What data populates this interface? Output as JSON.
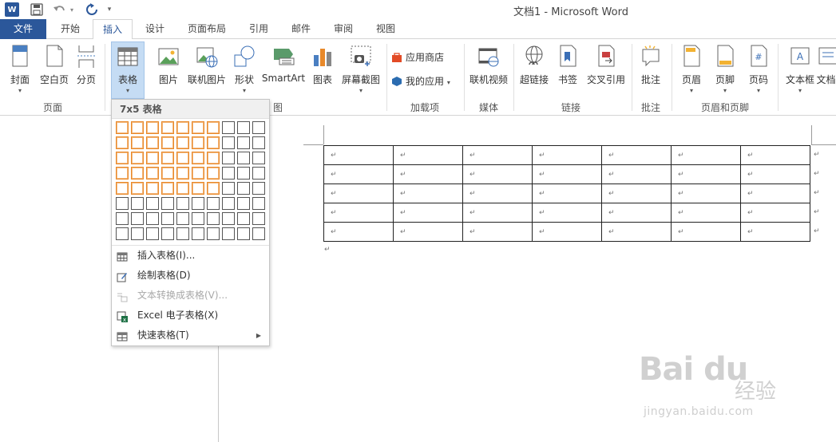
{
  "window": {
    "title": "文档1 - Microsoft Word"
  },
  "quick_access": {
    "logo_letter": "W",
    "undo_drop": "▾",
    "more": "▾"
  },
  "tabs": [
    {
      "label": "文件",
      "id": "file"
    },
    {
      "label": "开始",
      "id": "home"
    },
    {
      "label": "插入",
      "id": "insert",
      "active": true
    },
    {
      "label": "设计",
      "id": "design"
    },
    {
      "label": "页面布局",
      "id": "layout"
    },
    {
      "label": "引用",
      "id": "references"
    },
    {
      "label": "邮件",
      "id": "mailings"
    },
    {
      "label": "审阅",
      "id": "review"
    },
    {
      "label": "视图",
      "id": "view"
    }
  ],
  "ribbon": {
    "buttons": [
      {
        "label": "封面",
        "icon": "cover-page-icon",
        "dropdown": "▾"
      },
      {
        "label": "空白页",
        "icon": "blank-page-icon"
      },
      {
        "label": "分页",
        "icon": "page-break-icon"
      },
      {
        "label": "表格",
        "icon": "table-icon",
        "dropdown": "▾",
        "selected": true
      },
      {
        "label": "图片",
        "icon": "picture-icon"
      },
      {
        "label": "联机图片",
        "icon": "online-picture-icon"
      },
      {
        "label": "形状",
        "icon": "shapes-icon",
        "dropdown": "▾"
      },
      {
        "label": "SmartArt",
        "icon": "smartart-icon"
      },
      {
        "label": "图表",
        "icon": "chart-icon"
      },
      {
        "label": "屏幕截图",
        "icon": "screenshot-icon",
        "dropdown": "▾"
      },
      {
        "label": "联机视频",
        "icon": "online-video-icon"
      },
      {
        "label": "超链接",
        "icon": "hyperlink-icon"
      },
      {
        "label": "书签",
        "icon": "bookmark-icon"
      },
      {
        "label": "交叉引用",
        "icon": "cross-reference-icon"
      },
      {
        "label": "批注",
        "icon": "comment-icon"
      },
      {
        "label": "页眉",
        "icon": "header-icon",
        "dropdown": "▾"
      },
      {
        "label": "页脚",
        "icon": "footer-icon",
        "dropdown": "▾"
      },
      {
        "label": "页码",
        "icon": "page-number-icon",
        "dropdown": "▾"
      },
      {
        "label": "文本框",
        "icon": "textbox-icon",
        "dropdown": "▾"
      },
      {
        "label": "文档",
        "icon": "document-parts-icon"
      }
    ],
    "small_buttons": [
      {
        "label": "应用商店",
        "icon": "store-icon"
      },
      {
        "label": "我的应用",
        "icon": "my-apps-icon",
        "dropdown": "▾"
      }
    ],
    "groups": [
      {
        "label": "页面"
      },
      {
        "label": "图"
      },
      {
        "label": "加载项"
      },
      {
        "label": "媒体"
      },
      {
        "label": "链接"
      },
      {
        "label": "批注"
      },
      {
        "label": "页眉和页脚"
      }
    ],
    "colors": {
      "accent": "#2b579a",
      "selected_bg": "#c5dcf4",
      "grid_highlight": "#e8892a"
    }
  },
  "table_dropdown": {
    "header": "7x5 表格",
    "grid": {
      "cols": 10,
      "rows": 8,
      "highlight_cols": 7,
      "highlight_rows": 5
    },
    "menu": [
      {
        "label": "插入表格(I)...",
        "icon": "insert-table-icon",
        "enabled": true
      },
      {
        "label": "绘制表格(D)",
        "icon": "draw-table-icon",
        "enabled": true
      },
      {
        "label": "文本转换成表格(V)...",
        "icon": "convert-text-icon",
        "enabled": false
      },
      {
        "label": "Excel 电子表格(X)",
        "icon": "excel-icon",
        "enabled": true
      },
      {
        "label": "快速表格(T)",
        "icon": "quick-table-icon",
        "enabled": true,
        "submenu": "▶"
      }
    ]
  },
  "document": {
    "table": {
      "rows": 5,
      "cols": 7,
      "cell_mark": "↵"
    },
    "paragraph_mark": "↵"
  },
  "watermark": {
    "logo": "Bai du",
    "cn": "经验",
    "url": "jingyan.baidu.com"
  }
}
